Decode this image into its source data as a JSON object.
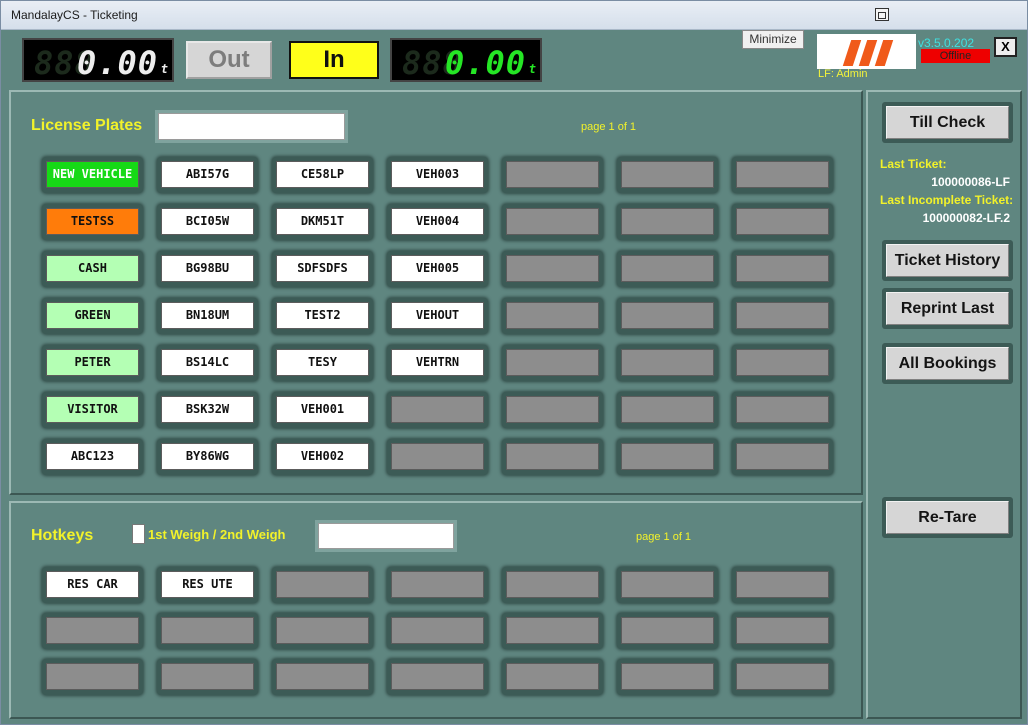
{
  "window": {
    "title": "MandalayCS - Ticketing"
  },
  "display": {
    "left_ghost": "888",
    "left_value": "0.00",
    "left_unit": "t",
    "out_label": "Out",
    "in_label": "In",
    "right_ghost": "888",
    "right_value": "0.00",
    "right_unit": "t"
  },
  "header": {
    "minimize_label": "Minimize",
    "version": "v3.5.0.202",
    "status": "Offline",
    "user": "LF: Admin",
    "close_label": "X"
  },
  "plates": {
    "label": "License Plates",
    "search_value": "",
    "pager": "page 1 of 1",
    "buttons": [
      {
        "label": "NEW VEHICLE",
        "style": "bright"
      },
      {
        "label": "ABI57G",
        "style": "white"
      },
      {
        "label": "CE58LP",
        "style": "white"
      },
      {
        "label": "VEH003",
        "style": "white"
      },
      {
        "label": "",
        "style": "gray"
      },
      {
        "label": "",
        "style": "gray"
      },
      {
        "label": "",
        "style": "gray"
      },
      {
        "label": "TESTSS",
        "style": "orange"
      },
      {
        "label": "BCI05W",
        "style": "white"
      },
      {
        "label": "DKM51T",
        "style": "white"
      },
      {
        "label": "VEH004",
        "style": "white"
      },
      {
        "label": "",
        "style": "gray"
      },
      {
        "label": "",
        "style": "gray"
      },
      {
        "label": "",
        "style": "gray"
      },
      {
        "label": "CASH",
        "style": "green"
      },
      {
        "label": "BG98BU",
        "style": "white"
      },
      {
        "label": "SDFSDFS",
        "style": "white"
      },
      {
        "label": "VEH005",
        "style": "white"
      },
      {
        "label": "",
        "style": "gray"
      },
      {
        "label": "",
        "style": "gray"
      },
      {
        "label": "",
        "style": "gray"
      },
      {
        "label": "GREEN",
        "style": "green"
      },
      {
        "label": "BN18UM",
        "style": "white"
      },
      {
        "label": "TEST2",
        "style": "white"
      },
      {
        "label": "VEHOUT",
        "style": "white"
      },
      {
        "label": "",
        "style": "gray"
      },
      {
        "label": "",
        "style": "gray"
      },
      {
        "label": "",
        "style": "gray"
      },
      {
        "label": "PETER",
        "style": "green"
      },
      {
        "label": "BS14LC",
        "style": "white"
      },
      {
        "label": "TESY",
        "style": "white"
      },
      {
        "label": "VEHTRN",
        "style": "white"
      },
      {
        "label": "",
        "style": "gray"
      },
      {
        "label": "",
        "style": "gray"
      },
      {
        "label": "",
        "style": "gray"
      },
      {
        "label": "VISITOR",
        "style": "green"
      },
      {
        "label": "BSK32W",
        "style": "white"
      },
      {
        "label": "VEH001",
        "style": "white"
      },
      {
        "label": "",
        "style": "gray"
      },
      {
        "label": "",
        "style": "gray"
      },
      {
        "label": "",
        "style": "gray"
      },
      {
        "label": "",
        "style": "gray"
      },
      {
        "label": "ABC123",
        "style": "white"
      },
      {
        "label": "BY86WG",
        "style": "white"
      },
      {
        "label": "VEH002",
        "style": "white"
      },
      {
        "label": "",
        "style": "gray"
      },
      {
        "label": "",
        "style": "gray"
      },
      {
        "label": "",
        "style": "gray"
      },
      {
        "label": "",
        "style": "gray"
      }
    ]
  },
  "hotkeys": {
    "label": "Hotkeys",
    "checkbox_label": "1st Weigh / 2nd Weigh",
    "checkbox_checked": false,
    "search_value": "",
    "pager": "page 1 of 1",
    "buttons": [
      {
        "label": "RES CAR",
        "style": "white"
      },
      {
        "label": "RES UTE",
        "style": "white"
      },
      {
        "label": "",
        "style": "gray"
      },
      {
        "label": "",
        "style": "gray"
      },
      {
        "label": "",
        "style": "gray"
      },
      {
        "label": "",
        "style": "gray"
      },
      {
        "label": "",
        "style": "gray"
      },
      {
        "label": "",
        "style": "gray"
      },
      {
        "label": "",
        "style": "gray"
      },
      {
        "label": "",
        "style": "gray"
      },
      {
        "label": "",
        "style": "gray"
      },
      {
        "label": "",
        "style": "gray"
      },
      {
        "label": "",
        "style": "gray"
      },
      {
        "label": "",
        "style": "gray"
      },
      {
        "label": "",
        "style": "gray"
      },
      {
        "label": "",
        "style": "gray"
      },
      {
        "label": "",
        "style": "gray"
      },
      {
        "label": "",
        "style": "gray"
      },
      {
        "label": "",
        "style": "gray"
      },
      {
        "label": "",
        "style": "gray"
      },
      {
        "label": "",
        "style": "gray"
      }
    ]
  },
  "sidebar": {
    "till_check": "Till Check",
    "last_ticket_label": "Last Ticket:",
    "last_ticket_value": "100000086-LF",
    "last_incomplete_label": "Last Incomplete Ticket:",
    "last_incomplete_value": "100000082-LF.2",
    "ticket_history": "Ticket History",
    "reprint_last": "Reprint Last",
    "all_bookings": "All Bookings",
    "re_tare": "Re-Tare"
  }
}
